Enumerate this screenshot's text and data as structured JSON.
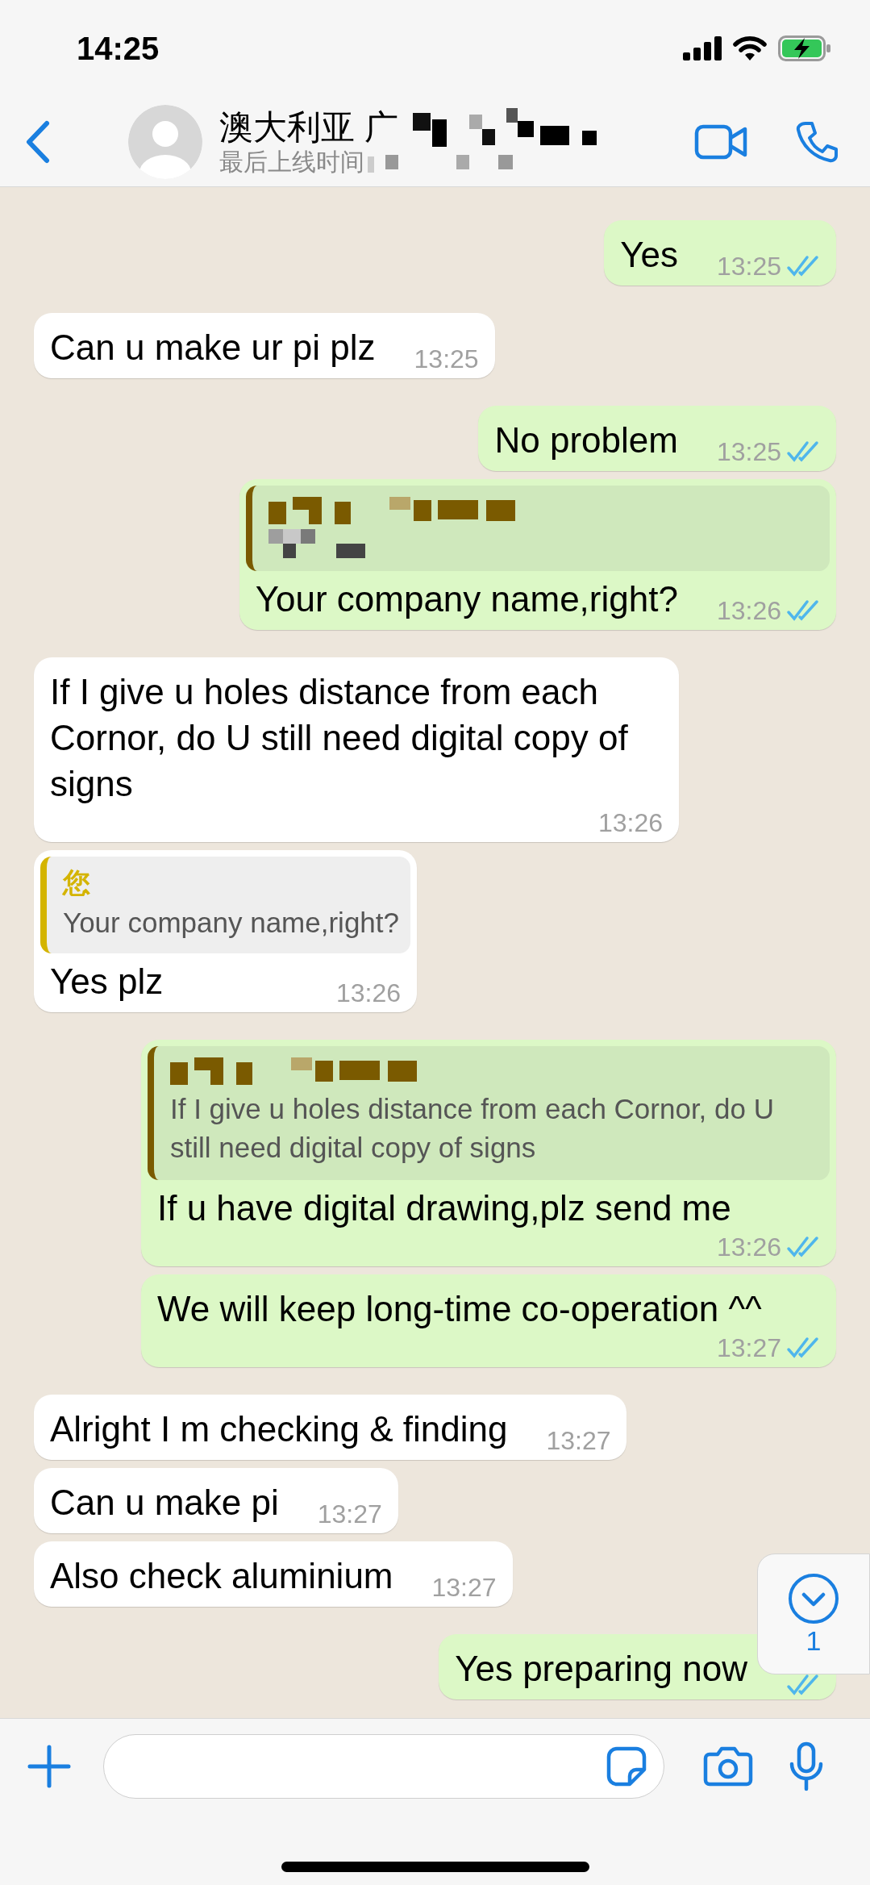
{
  "status_bar": {
    "time": "14:25"
  },
  "contact": {
    "name": "澳大利亚 广",
    "name_redacted": true,
    "last_seen": "最后上线时间",
    "last_seen_redacted": true
  },
  "messages": [
    {
      "kind": "outgoing",
      "text": "Yes",
      "time": "13:25",
      "read": true
    },
    {
      "kind": "incoming",
      "text": "Can u make ur pi plz",
      "time": "13:25"
    },
    {
      "kind": "outgoing",
      "text": "No problem",
      "time": "13:25",
      "read": true
    },
    {
      "kind": "outgoing",
      "quote": {
        "color": "#7a5a00",
        "author_redacted": true,
        "text_redacted": true
      },
      "text": "Your company name,right?",
      "time": "13:26",
      "read": true
    },
    {
      "kind": "incoming",
      "text": "If I give u holes distance from each Cornor, do U still need digital copy of signs",
      "time": "13:26"
    },
    {
      "kind": "incoming",
      "quote": {
        "color": "#d4b400",
        "author": "您",
        "text": "Your company name,right?"
      },
      "text": "Yes plz",
      "time": "13:26"
    },
    {
      "kind": "outgoing",
      "quote": {
        "color": "#7a5a00",
        "author_redacted": true,
        "text": "If I give u holes distance from each Cornor, do U still need digital copy of signs"
      },
      "text": "If u have digital drawing,plz send me",
      "time": "13:26",
      "read": true
    },
    {
      "kind": "outgoing",
      "text": "We will keep long-time co-operation ^^",
      "time": "13:27",
      "read": true
    },
    {
      "kind": "incoming",
      "text": "Alright I m checking & finding",
      "time": "13:27"
    },
    {
      "kind": "incoming",
      "text": "Can u make pi",
      "time": "13:27"
    },
    {
      "kind": "incoming",
      "text": "Also check aluminium",
      "time": "13:27"
    },
    {
      "kind": "outgoing",
      "text": "Yes preparing now",
      "read": true
    }
  ],
  "scroll_button": {
    "unread": "1"
  }
}
